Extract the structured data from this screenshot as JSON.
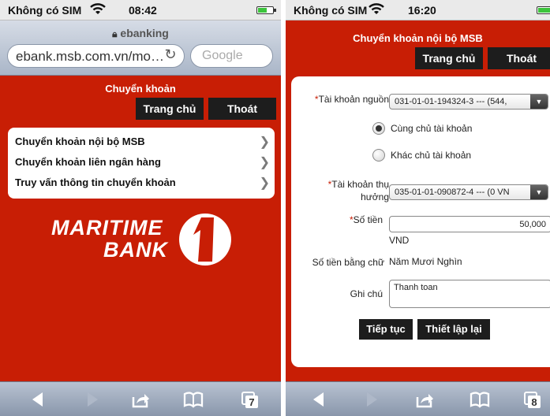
{
  "colors": {
    "brand_red": "#c81e05",
    "nav_button": "#1d1d1d",
    "status_bg": "#eaeaea",
    "toolbar": "#8996ab"
  },
  "left_phone": {
    "status": {
      "carrier": "Không có SIM",
      "time": "08:42",
      "battery_level": 0.6
    },
    "browser": {
      "page_title": "ebanking",
      "url": "ebank.msb.com.vn/mo…",
      "search_placeholder": "Google"
    },
    "page": {
      "subtitle": "Chuyển khoản",
      "home_label": "Trang chủ",
      "logout_label": "Thoát",
      "menu": [
        {
          "label": "Chuyển khoản nội bộ MSB"
        },
        {
          "label": "Chuyển khoản liên ngân hàng"
        },
        {
          "label": "Truy vấn thông tin chuyển khoản"
        }
      ],
      "logo": {
        "line1": "MARITIME",
        "line2": "BANK"
      }
    },
    "toolbar": {
      "tabs_count": "7"
    }
  },
  "right_phone": {
    "status": {
      "carrier": "Không có SIM",
      "time": "16:20",
      "battery_level": 1.0
    },
    "page": {
      "subtitle": "Chuyển khoản nội bộ MSB",
      "home_label": "Trang chủ",
      "logout_label": "Thoát",
      "form": {
        "source_label": "Tài khoản nguồn",
        "source_value": "031-01-01-194324-3 --- (544,",
        "radio_same_owner": "Cùng chủ tài khoản",
        "radio_other_owner": "Khác chủ tài khoản",
        "selected_radio": "same_owner",
        "beneficiary_label_1": "Tài khoản thụ",
        "beneficiary_label_2": "hưởng",
        "beneficiary_value": "035-01-01-090872-4 --- (0 VN",
        "amount_label": "Số tiền",
        "amount_value": "50,000",
        "currency": "VND",
        "amount_words_label": "Số tiền bằng chữ",
        "amount_words_value": "Năm Mươi Nghìn",
        "note_label": "Ghi chú",
        "note_value": "Thanh toan",
        "continue_label": "Tiếp tục",
        "reset_label": "Thiết lập lại"
      }
    },
    "toolbar": {
      "tabs_count": "8"
    }
  }
}
